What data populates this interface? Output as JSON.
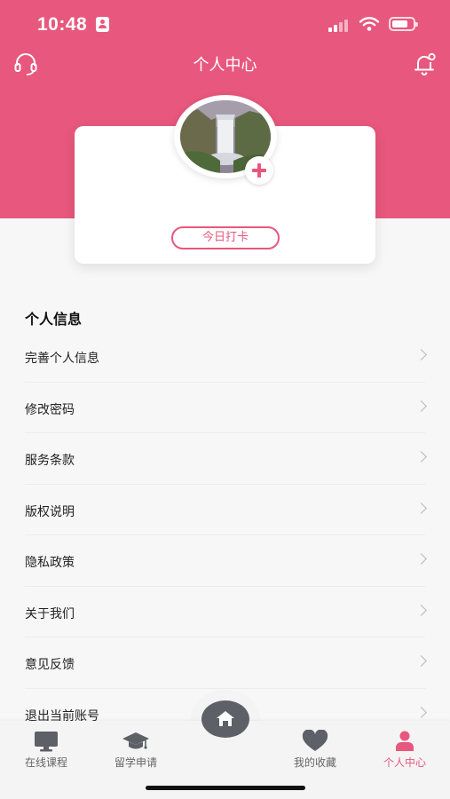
{
  "colors": {
    "accent": "#e8577d",
    "icon_gray": "#5e6068"
  },
  "status_bar": {
    "time": "10:48"
  },
  "header": {
    "title": "个人中心",
    "left_icon": "headset-icon",
    "right_icon": "bell-icon"
  },
  "profile": {
    "checkin_label": "今日打卡"
  },
  "section": {
    "title": "个人信息"
  },
  "menu": [
    {
      "label": "完善个人信息"
    },
    {
      "label": "修改密码"
    },
    {
      "label": "服务条款"
    },
    {
      "label": "版权说明"
    },
    {
      "label": "隐私政策"
    },
    {
      "label": "关于我们"
    },
    {
      "label": "意见反馈"
    },
    {
      "label": "退出当前账号"
    }
  ],
  "tabs": [
    {
      "label": "在线课程",
      "icon": "monitor-icon"
    },
    {
      "label": "留学申请",
      "icon": "graduation-cap-icon"
    },
    {
      "label": "我的收藏",
      "icon": "heart-icon"
    },
    {
      "label": "个人中心",
      "icon": "person-icon",
      "active": true
    }
  ],
  "home_button": {
    "icon": "home-icon"
  }
}
